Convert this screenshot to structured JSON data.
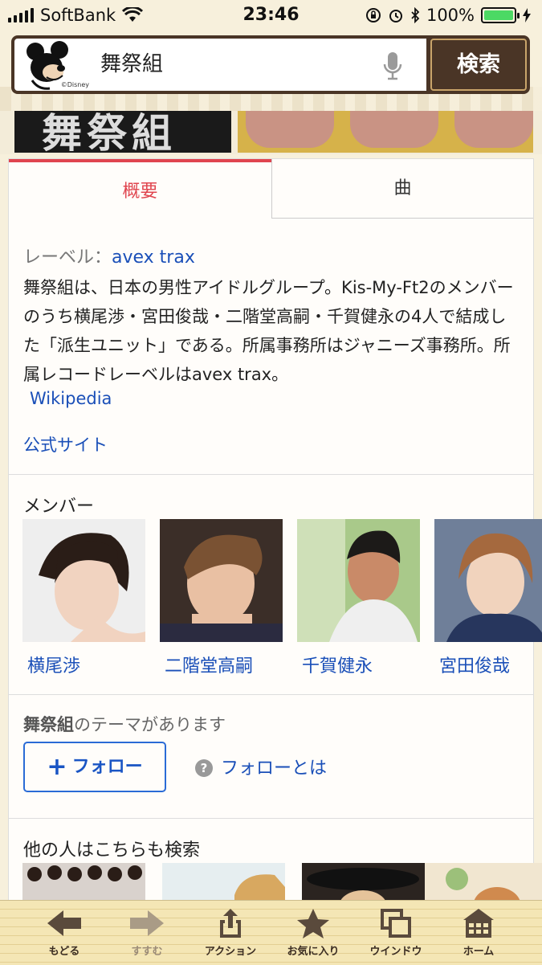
{
  "status_bar": {
    "carrier": "SoftBank",
    "time": "23:46",
    "battery": "100%",
    "battery_level": 1.0,
    "icons": [
      "signal-icon",
      "wifi-icon",
      "rotation-lock-icon",
      "alarm-icon",
      "bluetooth-icon",
      "battery-icon",
      "charging-icon"
    ]
  },
  "search": {
    "logo_caption": "©Disney",
    "query": "舞祭組",
    "button_label": "検索",
    "icons": [
      "mickey-logo-icon",
      "microphone-icon"
    ]
  },
  "hero": {
    "left_caption": "舞祭組"
  },
  "tabs": [
    {
      "label": "概要",
      "active": true
    },
    {
      "label": "曲",
      "active": false
    }
  ],
  "overview": {
    "label_prefix": "レーベル：",
    "label_value": "avex trax",
    "description": "舞祭組は、日本の男性アイドルグループ。Kis-My-Ft2のメンバーのうち横尾渉・宮田俊哉・二階堂高嗣・千賀健永の4人で結成した「派生ユニット」である。所属事務所はジャニーズ事務所。所属レコードレーベルはavex trax。",
    "source_link": "Wikipedia",
    "official_link": "公式サイト"
  },
  "members": {
    "title": "メンバー",
    "items": [
      {
        "name": "横尾渉"
      },
      {
        "name": "二階堂高嗣"
      },
      {
        "name": "千賀健永"
      },
      {
        "name": "宮田俊哉"
      }
    ]
  },
  "theme": {
    "name": "舞祭組",
    "suffix": "のテーマがあります",
    "follow_label": "フォロー",
    "what_label": "フォローとは"
  },
  "others": {
    "title": "他の人はこちらも検索"
  },
  "toolbar": {
    "items": [
      {
        "label": "もどる",
        "icon": "back-arrow-icon",
        "enabled": true
      },
      {
        "label": "すすむ",
        "icon": "forward-arrow-icon",
        "enabled": false
      },
      {
        "label": "アクション",
        "icon": "share-icon",
        "enabled": true
      },
      {
        "label": "お気に入り",
        "icon": "star-icon",
        "enabled": true
      },
      {
        "label": "ウインドウ",
        "icon": "windows-icon",
        "enabled": true
      },
      {
        "label": "ホーム",
        "icon": "home-icon",
        "enabled": true
      }
    ]
  },
  "colors": {
    "accent_tab": "#e0454f",
    "link": "#1a4fb8",
    "search_frame": "#4a3526",
    "toolbar_bg": "#f4e6b5"
  }
}
